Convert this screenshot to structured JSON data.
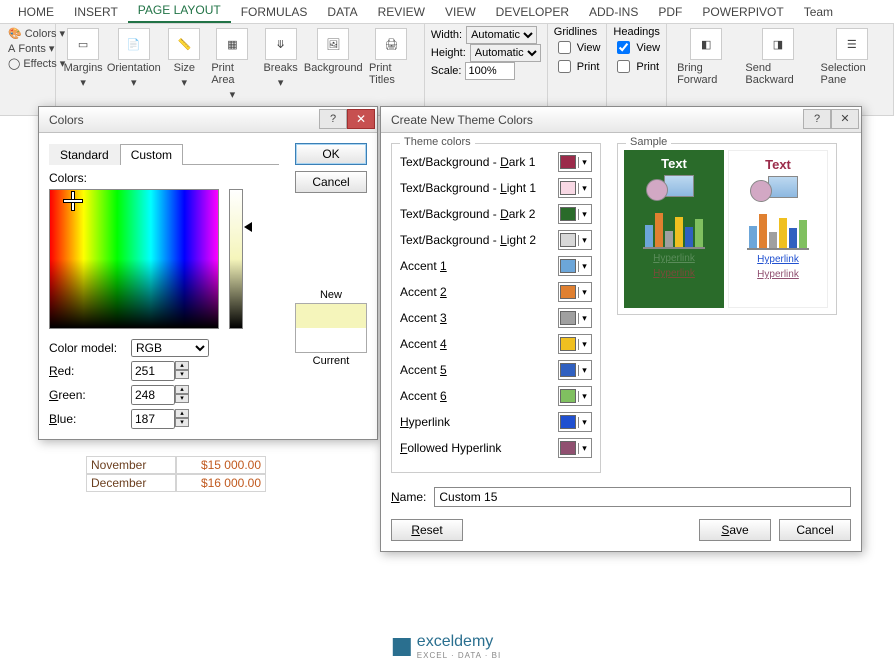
{
  "ribbon": {
    "tabs": [
      "HOME",
      "INSERT",
      "PAGE LAYOUT",
      "FORMULAS",
      "DATA",
      "REVIEW",
      "VIEW",
      "DEVELOPER",
      "ADD-INS",
      "PDF",
      "POWERPIVOT",
      "Team"
    ],
    "active_tab": "PAGE LAYOUT",
    "themes": {
      "colors": "Colors",
      "fonts": "Fonts",
      "effects": "Effects"
    },
    "page_setup": {
      "margins": "Margins",
      "orientation": "Orientation",
      "size": "Size",
      "print_area": "Print Area",
      "breaks": "Breaks",
      "background": "Background",
      "print_titles": "Print Titles"
    },
    "scale": {
      "width_lbl": "Width:",
      "width_val": "Automatic",
      "height_lbl": "Height:",
      "height_val": "Automatic",
      "scale_lbl": "Scale:",
      "scale_val": "100%"
    },
    "gridlines": {
      "title": "Gridlines",
      "view": "View",
      "print": "Print"
    },
    "headings": {
      "title": "Headings",
      "view": "View",
      "print": "Print"
    },
    "arrange": {
      "bring": "Bring Forward",
      "send": "Send Backward",
      "selection": "Selection Pane"
    }
  },
  "sheet": {
    "rows": [
      {
        "a": "November",
        "b": "$15 000.00"
      },
      {
        "a": "December",
        "b": "$16 000.00"
      }
    ]
  },
  "colors_dlg": {
    "title": "Colors",
    "tab_standard": "Standard",
    "tab_custom": "Custom",
    "colors_lbl": "Colors:",
    "model_lbl": "Color model:",
    "model_val": "RGB",
    "red_lbl": "Red:",
    "red_val": "251",
    "green_lbl": "Green:",
    "green_val": "248",
    "blue_lbl": "Blue:",
    "blue_val": "187",
    "ok": "OK",
    "cancel": "Cancel",
    "new_lbl": "New",
    "current_lbl": "Current"
  },
  "theme_dlg": {
    "title": "Create New Theme Colors",
    "section": "Theme colors",
    "sample": "Sample",
    "items": [
      {
        "label": "Text/Background - Dark 1",
        "accel": "D",
        "color": "#9b2b4a"
      },
      {
        "label": "Text/Background - Light 1",
        "accel": "L",
        "color": "#f8d8e4"
      },
      {
        "label": "Text/Background - Dark 2",
        "accel": "D",
        "color": "#2a6b2a"
      },
      {
        "label": "Text/Background - Light 2",
        "accel": "L",
        "color": "#d8d8d8"
      },
      {
        "label": "Accent 1",
        "accel": "1",
        "color": "#6ca6d9"
      },
      {
        "label": "Accent 2",
        "accel": "2",
        "color": "#e08030"
      },
      {
        "label": "Accent 3",
        "accel": "3",
        "color": "#a0a0a0"
      },
      {
        "label": "Accent 4",
        "accel": "4",
        "color": "#f0c020"
      },
      {
        "label": "Accent 5",
        "accel": "5",
        "color": "#3060c0"
      },
      {
        "label": "Accent 6",
        "accel": "6",
        "color": "#80c060"
      },
      {
        "label": "Hyperlink",
        "accel": "H",
        "color": "#2050d0"
      },
      {
        "label": "Followed Hyperlink",
        "accel": "F",
        "color": "#905070"
      }
    ],
    "sample_text": "Text",
    "sample_link": "Hyperlink",
    "name_lbl": "Name:",
    "name_val": "Custom 15",
    "reset": "Reset",
    "save": "Save",
    "cancel": "Cancel"
  },
  "footer": {
    "brand": "exceldemy",
    "sub": "EXCEL · DATA · BI"
  }
}
